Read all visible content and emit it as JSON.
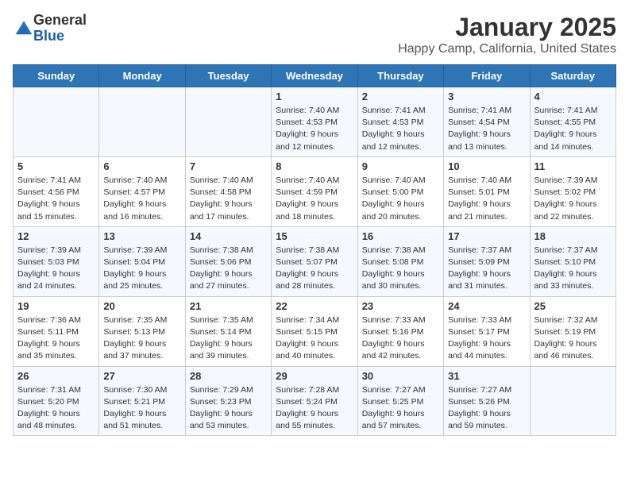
{
  "logo": {
    "general": "General",
    "blue": "Blue"
  },
  "title": "January 2025",
  "subtitle": "Happy Camp, California, United States",
  "weekdays": [
    "Sunday",
    "Monday",
    "Tuesday",
    "Wednesday",
    "Thursday",
    "Friday",
    "Saturday"
  ],
  "weeks": [
    [
      {
        "day": "",
        "info": ""
      },
      {
        "day": "",
        "info": ""
      },
      {
        "day": "",
        "info": ""
      },
      {
        "day": "1",
        "info": "Sunrise: 7:40 AM\nSunset: 4:53 PM\nDaylight: 9 hours\nand 12 minutes."
      },
      {
        "day": "2",
        "info": "Sunrise: 7:41 AM\nSunset: 4:53 PM\nDaylight: 9 hours\nand 12 minutes."
      },
      {
        "day": "3",
        "info": "Sunrise: 7:41 AM\nSunset: 4:54 PM\nDaylight: 9 hours\nand 13 minutes."
      },
      {
        "day": "4",
        "info": "Sunrise: 7:41 AM\nSunset: 4:55 PM\nDaylight: 9 hours\nand 14 minutes."
      }
    ],
    [
      {
        "day": "5",
        "info": "Sunrise: 7:41 AM\nSunset: 4:56 PM\nDaylight: 9 hours\nand 15 minutes."
      },
      {
        "day": "6",
        "info": "Sunrise: 7:40 AM\nSunset: 4:57 PM\nDaylight: 9 hours\nand 16 minutes."
      },
      {
        "day": "7",
        "info": "Sunrise: 7:40 AM\nSunset: 4:58 PM\nDaylight: 9 hours\nand 17 minutes."
      },
      {
        "day": "8",
        "info": "Sunrise: 7:40 AM\nSunset: 4:59 PM\nDaylight: 9 hours\nand 18 minutes."
      },
      {
        "day": "9",
        "info": "Sunrise: 7:40 AM\nSunset: 5:00 PM\nDaylight: 9 hours\nand 20 minutes."
      },
      {
        "day": "10",
        "info": "Sunrise: 7:40 AM\nSunset: 5:01 PM\nDaylight: 9 hours\nand 21 minutes."
      },
      {
        "day": "11",
        "info": "Sunrise: 7:39 AM\nSunset: 5:02 PM\nDaylight: 9 hours\nand 22 minutes."
      }
    ],
    [
      {
        "day": "12",
        "info": "Sunrise: 7:39 AM\nSunset: 5:03 PM\nDaylight: 9 hours\nand 24 minutes."
      },
      {
        "day": "13",
        "info": "Sunrise: 7:39 AM\nSunset: 5:04 PM\nDaylight: 9 hours\nand 25 minutes."
      },
      {
        "day": "14",
        "info": "Sunrise: 7:38 AM\nSunset: 5:06 PM\nDaylight: 9 hours\nand 27 minutes."
      },
      {
        "day": "15",
        "info": "Sunrise: 7:38 AM\nSunset: 5:07 PM\nDaylight: 9 hours\nand 28 minutes."
      },
      {
        "day": "16",
        "info": "Sunrise: 7:38 AM\nSunset: 5:08 PM\nDaylight: 9 hours\nand 30 minutes."
      },
      {
        "day": "17",
        "info": "Sunrise: 7:37 AM\nSunset: 5:09 PM\nDaylight: 9 hours\nand 31 minutes."
      },
      {
        "day": "18",
        "info": "Sunrise: 7:37 AM\nSunset: 5:10 PM\nDaylight: 9 hours\nand 33 minutes."
      }
    ],
    [
      {
        "day": "19",
        "info": "Sunrise: 7:36 AM\nSunset: 5:11 PM\nDaylight: 9 hours\nand 35 minutes."
      },
      {
        "day": "20",
        "info": "Sunrise: 7:35 AM\nSunset: 5:13 PM\nDaylight: 9 hours\nand 37 minutes."
      },
      {
        "day": "21",
        "info": "Sunrise: 7:35 AM\nSunset: 5:14 PM\nDaylight: 9 hours\nand 39 minutes."
      },
      {
        "day": "22",
        "info": "Sunrise: 7:34 AM\nSunset: 5:15 PM\nDaylight: 9 hours\nand 40 minutes."
      },
      {
        "day": "23",
        "info": "Sunrise: 7:33 AM\nSunset: 5:16 PM\nDaylight: 9 hours\nand 42 minutes."
      },
      {
        "day": "24",
        "info": "Sunrise: 7:33 AM\nSunset: 5:17 PM\nDaylight: 9 hours\nand 44 minutes."
      },
      {
        "day": "25",
        "info": "Sunrise: 7:32 AM\nSunset: 5:19 PM\nDaylight: 9 hours\nand 46 minutes."
      }
    ],
    [
      {
        "day": "26",
        "info": "Sunrise: 7:31 AM\nSunset: 5:20 PM\nDaylight: 9 hours\nand 48 minutes."
      },
      {
        "day": "27",
        "info": "Sunrise: 7:30 AM\nSunset: 5:21 PM\nDaylight: 9 hours\nand 51 minutes."
      },
      {
        "day": "28",
        "info": "Sunrise: 7:29 AM\nSunset: 5:23 PM\nDaylight: 9 hours\nand 53 minutes."
      },
      {
        "day": "29",
        "info": "Sunrise: 7:28 AM\nSunset: 5:24 PM\nDaylight: 9 hours\nand 55 minutes."
      },
      {
        "day": "30",
        "info": "Sunrise: 7:27 AM\nSunset: 5:25 PM\nDaylight: 9 hours\nand 57 minutes."
      },
      {
        "day": "31",
        "info": "Sunrise: 7:27 AM\nSunset: 5:26 PM\nDaylight: 9 hours\nand 59 minutes."
      },
      {
        "day": "",
        "info": ""
      }
    ]
  ]
}
